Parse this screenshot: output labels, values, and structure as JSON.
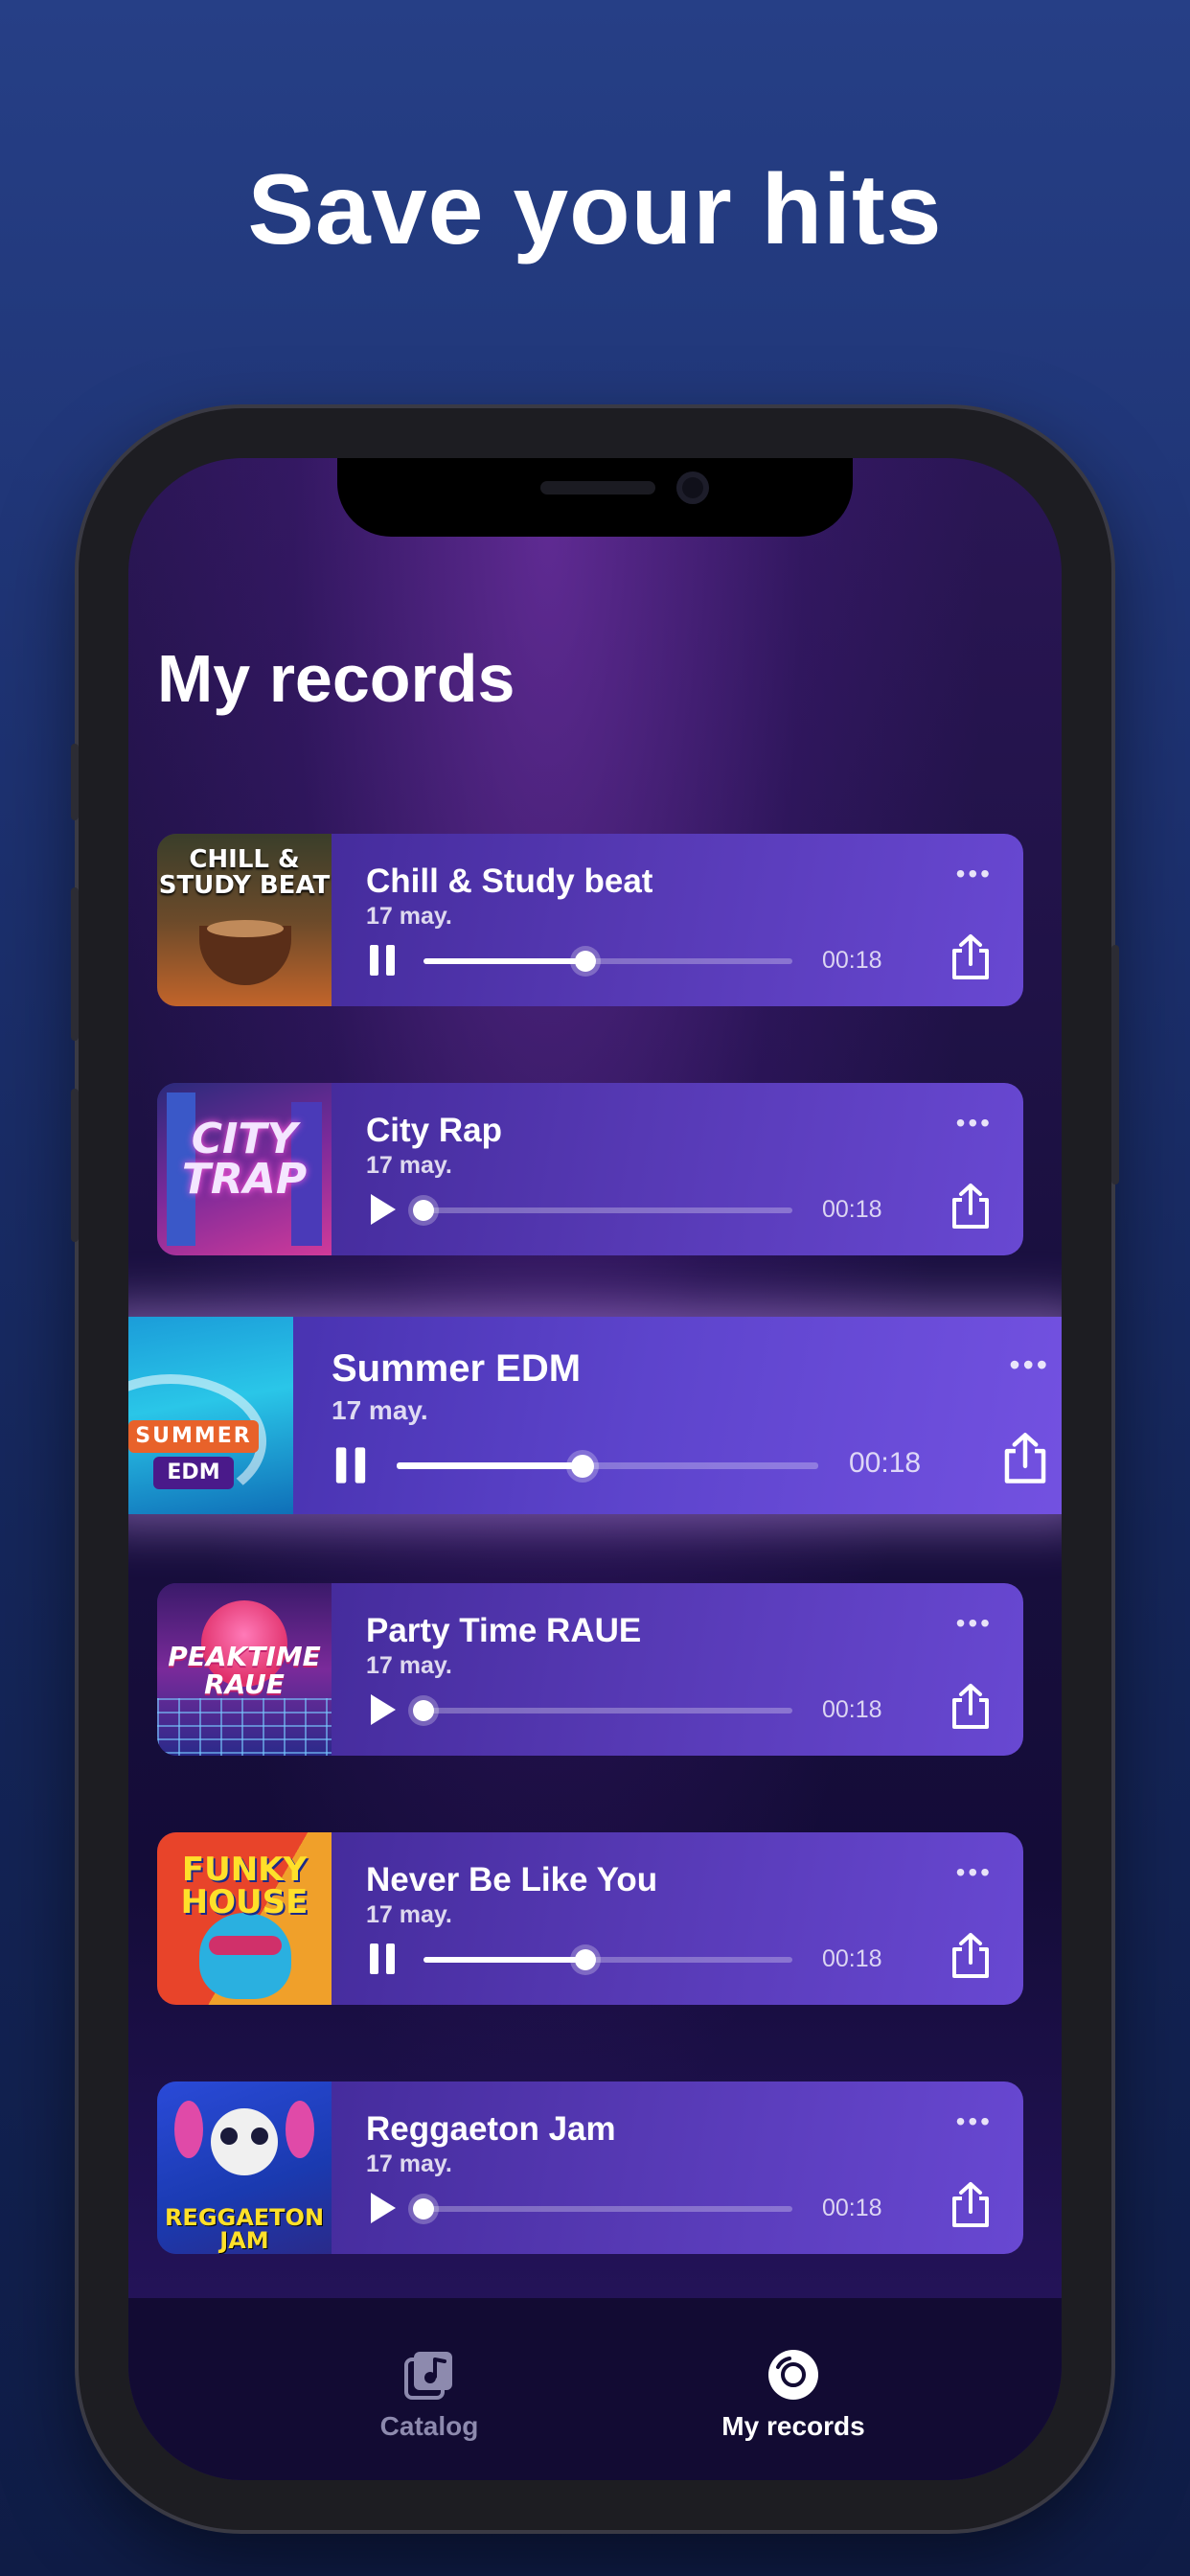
{
  "headline": "Save your hits",
  "screen": {
    "title": "My records",
    "records": [
      {
        "title": "Chill & Study beat",
        "date": "17 may.",
        "time": "00:18",
        "state": "playing",
        "progress": 0.44,
        "art_label": "CHILL & STUDY BEAT"
      },
      {
        "title": "City Rap",
        "date": "17 may.",
        "time": "00:18",
        "state": "paused",
        "progress": 0.0,
        "art_label": "CITY TRAP"
      },
      {
        "title": "Summer EDM",
        "date": "17 may.",
        "time": "00:18",
        "state": "playing",
        "progress": 0.44,
        "art_label_1": "SUMMER",
        "art_label_2": "EDM"
      },
      {
        "title": "Party Time RAUE",
        "date": "17 may.",
        "time": "00:18",
        "state": "paused",
        "progress": 0.0,
        "art_label": "PEAKTIME RAUE"
      },
      {
        "title": "Never Be Like You",
        "date": "17 may.",
        "time": "00:18",
        "state": "playing",
        "progress": 0.44,
        "art_label": "FUNKY HOUSE"
      },
      {
        "title": "Reggaeton Jam",
        "date": "17 may.",
        "time": "00:18",
        "state": "paused",
        "progress": 0.0,
        "art_label": "REGGAETON JAM"
      }
    ],
    "more_label": "•••",
    "tabs": [
      {
        "label": "Catalog",
        "icon": "music-note-icon",
        "active": false
      },
      {
        "label": "My records",
        "icon": "vinyl-record-icon",
        "active": true
      }
    ]
  },
  "colors": {
    "background_top": "#263f86",
    "card_accent": "#5639b4",
    "tab_inactive": "#8d8aae",
    "tab_active": "#ffffff"
  }
}
